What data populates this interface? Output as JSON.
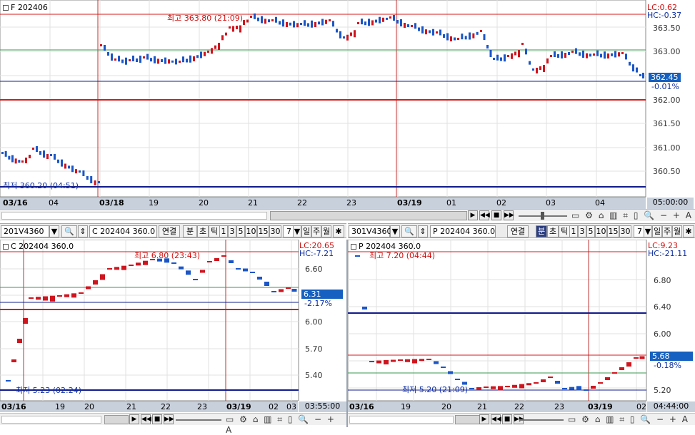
{
  "top": {
    "legend": "F 202406",
    "lc": "LC:0.62",
    "hc": "HC:-0.37",
    "high_note": "최고 363.80 (21:09)",
    "low_note": "최저 360.20 (04:51)",
    "price_labels": [
      "363.50",
      "363.00",
      "362.00",
      "361.50",
      "361.00",
      "360.50"
    ],
    "current_price": "362.45",
    "current_change": "-0.01%",
    "x_labels": [
      "03/16",
      "04",
      "03/18",
      "19",
      "20",
      "21",
      "22",
      "23",
      "03/19",
      "01",
      "02",
      "03",
      "04"
    ],
    "time_box": "05:00:00"
  },
  "toolbar_left": {
    "code": "201V4360",
    "series": "C 202404  360.0",
    "link": "연결",
    "periods": [
      "분",
      "초",
      "틱"
    ],
    "intervals": [
      "1",
      "3",
      "5",
      "10",
      "15",
      "30"
    ],
    "count": "7",
    "units": [
      "일",
      "주",
      "월"
    ]
  },
  "toolbar_right": {
    "code": "301V4360",
    "series": "P  202404  360.0",
    "link": "연결",
    "periods": [
      "분",
      "초",
      "틱"
    ],
    "intervals": [
      "1",
      "3",
      "5",
      "10",
      "15",
      "30"
    ],
    "count": "7",
    "units": [
      "일",
      "주",
      "월"
    ]
  },
  "left_chart": {
    "legend": "C 202404 360.0",
    "lc": "LC:20.65",
    "hc": "HC:-7.21",
    "high_note": "최고 6.80 (23:43)",
    "low_note": "최저 5.23 (02:24)",
    "price_labels": [
      "6.60",
      "6.00",
      "5.70",
      "5.40"
    ],
    "current_price": "6.31",
    "current_change": "-2.17%",
    "x_labels": [
      "03/16",
      "19",
      "20",
      "21",
      "22",
      "23",
      "03/19",
      "02",
      "03"
    ],
    "time_box": "03:55:00"
  },
  "right_chart": {
    "legend": "P 202404 360.0",
    "lc": "LC:9.23",
    "hc": "HC:-21.11",
    "high_note": "최고 7.20 (04:44)",
    "low_note": "최저 5.20 (21:09)",
    "price_labels": [
      "6.80",
      "6.40",
      "6.00",
      "5.20"
    ],
    "current_price": "5.68",
    "current_change": "-0.18%",
    "x_labels": [
      "03/16",
      "19",
      "20",
      "21",
      "22",
      "23",
      "03/19",
      "02"
    ],
    "time_box": "04:44:00"
  },
  "colors": {
    "up": "#d0141e",
    "down": "#1a56c8",
    "accent": "#2c3e80"
  }
}
